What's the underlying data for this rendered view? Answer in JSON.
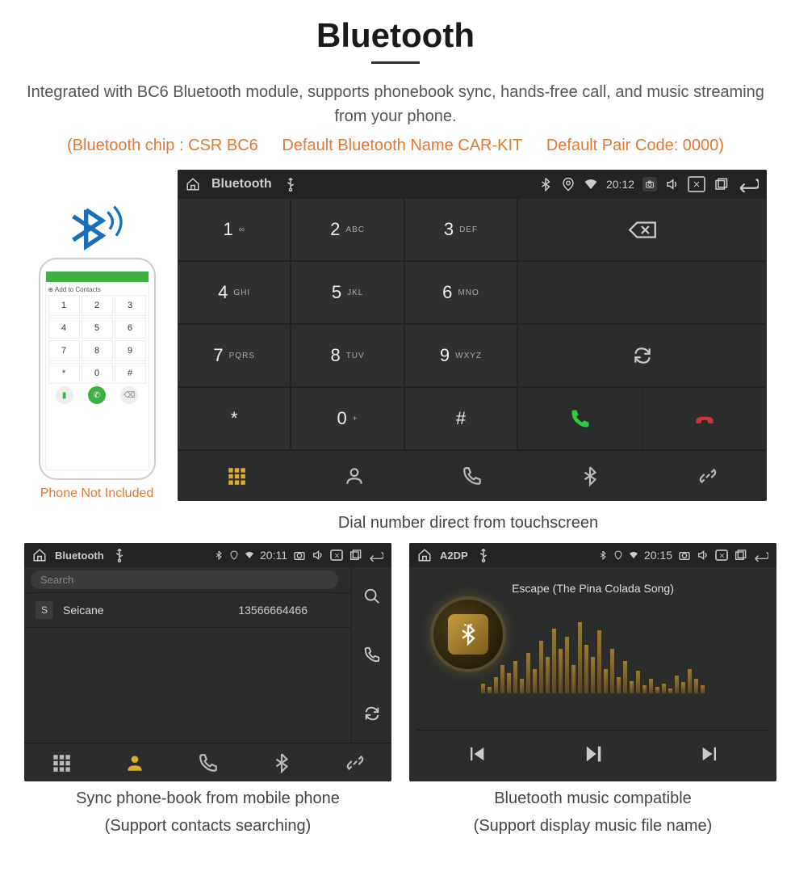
{
  "header": {
    "title": "Bluetooth",
    "subtitle": "Integrated with BC6 Bluetooth module, supports phonebook sync, hands-free call, and music streaming from your phone.",
    "spec_chip": "(Bluetooth chip : CSR BC6",
    "spec_name": "Default Bluetooth Name CAR-KIT",
    "spec_code": "Default Pair Code: 0000)"
  },
  "phone": {
    "caption": "Phone Not Included",
    "add_contacts": "Add to Contacts",
    "keys": [
      "1",
      "2",
      "3",
      "4",
      "5",
      "6",
      "7",
      "8",
      "9",
      "*",
      "0",
      "#"
    ]
  },
  "status": {
    "app1": "Bluetooth",
    "app2": "Bluetooth",
    "app3": "A2DP",
    "time1": "20:12",
    "time2": "20:11",
    "time3": "20:15"
  },
  "dialer": {
    "keys": [
      {
        "n": "1",
        "s": "∞"
      },
      {
        "n": "2",
        "s": "ABC"
      },
      {
        "n": "3",
        "s": "DEF"
      },
      {
        "n": "4",
        "s": "GHI"
      },
      {
        "n": "5",
        "s": "JKL"
      },
      {
        "n": "6",
        "s": "MNO"
      },
      {
        "n": "7",
        "s": "PQRS"
      },
      {
        "n": "8",
        "s": "TUV"
      },
      {
        "n": "9",
        "s": "WXYZ"
      },
      {
        "n": "*",
        "s": ""
      },
      {
        "n": "0",
        "s": "+"
      },
      {
        "n": "#",
        "s": ""
      }
    ],
    "caption": "Dial number direct from touchscreen"
  },
  "contacts": {
    "search_placeholder": "Search",
    "rows": [
      {
        "letter": "S",
        "name": "Seicane",
        "number": "13566664466"
      }
    ],
    "caption1": "Sync phone-book from mobile phone",
    "caption2": "(Support contacts searching)"
  },
  "music": {
    "song": "Escape (The Pina Colada Song)",
    "caption1": "Bluetooth music compatible",
    "caption2": "(Support display music file name)",
    "eq_heights": [
      12,
      8,
      20,
      35,
      25,
      40,
      18,
      50,
      30,
      65,
      45,
      80,
      55,
      70,
      35,
      88,
      60,
      45,
      78,
      30,
      55,
      20,
      40,
      15,
      28,
      10,
      18,
      8,
      12,
      6,
      22,
      14,
      30,
      18,
      10
    ]
  }
}
